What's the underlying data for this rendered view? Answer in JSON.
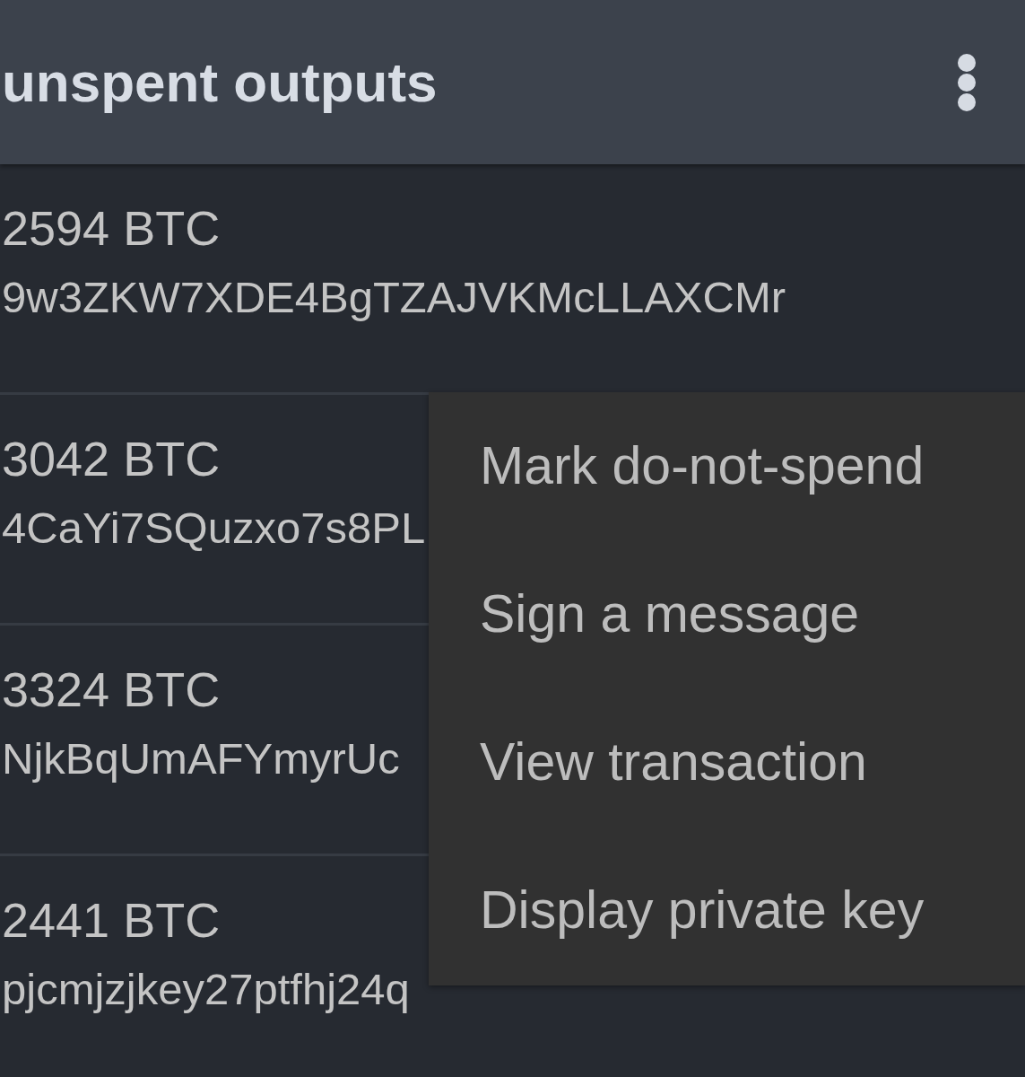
{
  "app_bar": {
    "title": "unspent outputs"
  },
  "outputs": [
    {
      "amount": "2594 BTC",
      "address": "9w3ZKW7XDE4BgTZAJVKMcLLAXCMr"
    },
    {
      "amount": "3042 BTC",
      "address": "4CaYi7SQuzxo7s8PL"
    },
    {
      "amount": "3324 BTC",
      "address": "NjkBqUmAFYmyrUc"
    },
    {
      "amount": "2441 BTC",
      "address": "pjcmjzjkey27ptfhj24q"
    }
  ],
  "context_menu": {
    "items": [
      "Mark do-not-spend",
      "Sign a message",
      "View transaction",
      "Display private key"
    ]
  }
}
